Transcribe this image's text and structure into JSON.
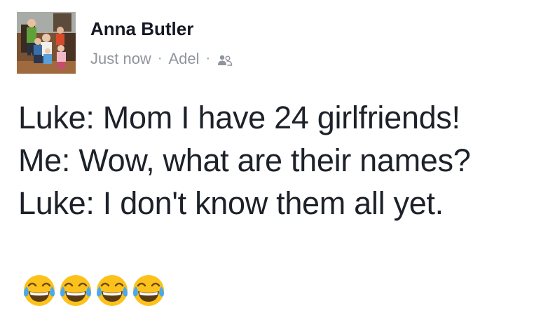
{
  "post": {
    "author": "Anna Butler",
    "timestamp": "Just now",
    "location": "Adel",
    "separator": "·",
    "audience_icon": "friends-icon",
    "lines": [
      "Luke: Mom I have 24 girlfriends!",
      "Me: Wow, what are their names?",
      "Luke: I don't know them all yet."
    ],
    "emojis": [
      "face-with-tears-of-joy-icon",
      "face-with-tears-of-joy-icon",
      "face-with-tears-of-joy-icon",
      "face-with-tears-of-joy-icon"
    ]
  },
  "colors": {
    "name": "#141823",
    "meta": "#90949c",
    "body": "#1d2129",
    "emoji_face": "#fcc21b"
  }
}
